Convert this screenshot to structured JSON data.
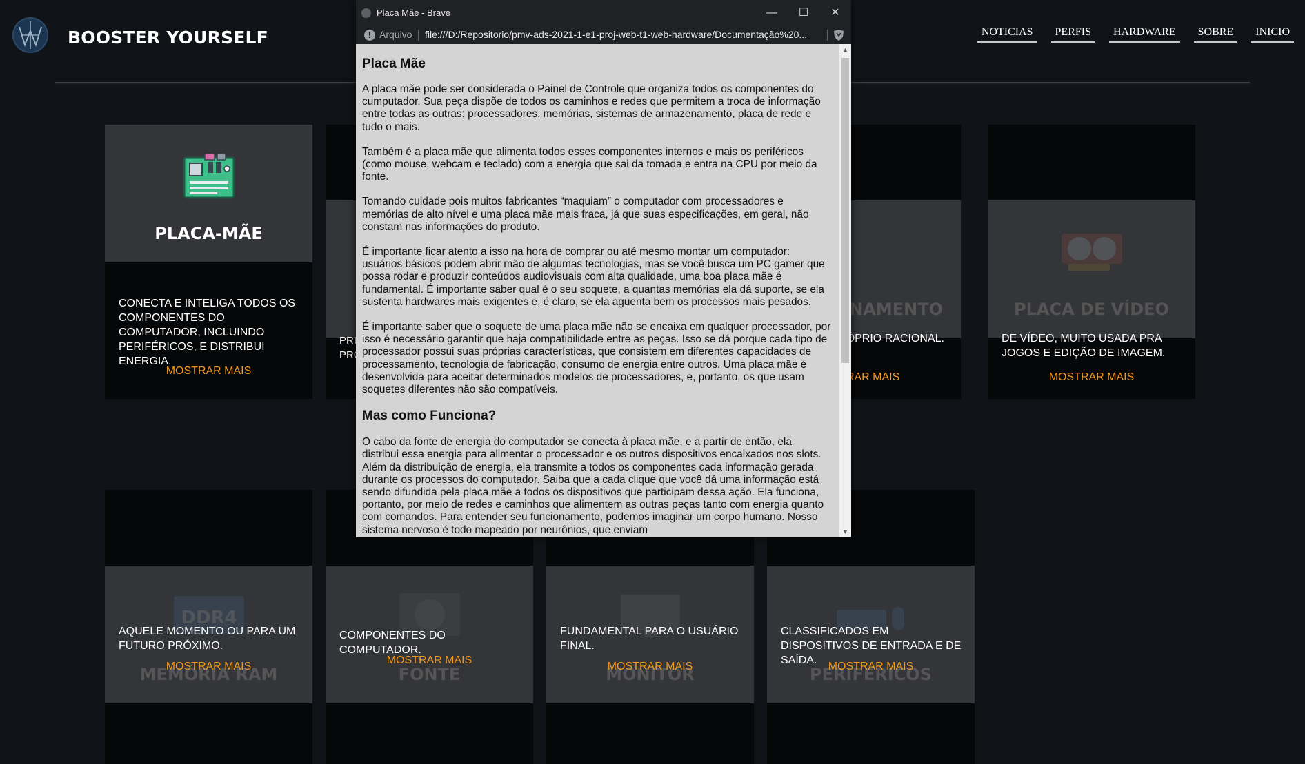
{
  "site": {
    "brand": "BOOSTER YOURSELF",
    "nav": [
      "NOTICIAS",
      "PERFIS",
      "HARDWARE",
      "SOBRE",
      "INICIO"
    ]
  },
  "cards": {
    "row1": [
      {
        "title": "PLACA-MÃE",
        "icon": "motherboard-icon",
        "text": "CONECTA E INTELIGA TODOS OS COMPONENTES DO COMPUTADOR, INCLUINDO PERIFÉRICOS, E DISTRIBUI ENERGIA.",
        "more": "MOSTRAR MAIS"
      },
      {
        "title": "",
        "icon": "cpu-icon",
        "text": "PRI PRO",
        "more": ""
      },
      {
        "title": "",
        "icon": "",
        "text": "",
        "more": ""
      },
      {
        "title": "ARMAZENAMENTO",
        "title_visible": "ZENAMENTO",
        "icon": "hdd-icon",
        "text_visible": "JOGOS E O PRÓPRIO RACIONAL.",
        "more": "MOSTRAR MAIS",
        "more_visible": "STRAR MAIS"
      },
      {
        "title": "PLACA DE VÍDEO",
        "icon": "gpu-icon",
        "text": "DE VÍDEO, MUITO USADA PRA JOGOS E EDIÇÃO DE IMAGEM.",
        "more": "MOSTRAR MAIS"
      }
    ],
    "row2": [
      {
        "title": "MEMÓRIA RAM",
        "icon": "ram-icon",
        "icon_text": "DDR4",
        "text": "AQUELE MOMENTO OU PARA UM FUTURO PRÓXIMO.",
        "more": "MOSTRAR MAIS"
      },
      {
        "title": "FONTE",
        "icon": "psu-icon",
        "text": "COMPONENTES DO COMPUTADOR.",
        "more": "MOSTRAR MAIS"
      },
      {
        "title": "MONITOR",
        "icon": "monitor-icon",
        "text": "FUNDAMENTAL PARA O USUÁRIO FINAL.",
        "more": "MOSTRAR MAIS"
      },
      {
        "title": "PERIFÉRICOS",
        "icon": "keyboard-mouse-icon",
        "text": "CLASSIFICADOS EM DISPOSITIVOS DE ENTRADA E DE SAÍDA.",
        "more": "MOSTRAR MAIS"
      }
    ]
  },
  "popup": {
    "window_title": "Placa Mãe - Brave",
    "address_label": "Arquivo",
    "url": "file:///D:/Repositorio/pmv-ads-2021-1-e1-proj-web-t1-web-hardware/Documentação%20...",
    "h1": "Placa Mãe",
    "paragraphs": [
      "A placa mãe pode ser considerada o Painel de Controle que organiza todos os componentes do cumputador. Sua peça dispõe de todos os caminhos e redes que permitem a troca de informação entre todas as outras: processadores, memórias, sistemas de armazenamento, placa de rede e tudo o mais.",
      "Também é a placa mãe que alimenta todos esses componentes internos e mais os periféricos (como mouse, webcam e teclado) com a energia que sai da tomada e entra na CPU por meio da fonte.",
      "Tomando cuidade pois muitos fabricantes “maquiam” o computador com processadores e memórias de alto nível e uma placa mãe mais fraca, já que suas especificações, em geral, não constam nas informações do produto.",
      "É importante ficar atento a isso na hora de comprar ou até mesmo montar um computador: usuários básicos podem abrir mão de algumas tecnologias, mas se você busca um PC gamer que possa rodar e produzir conteúdos audiovisuais com alta qualidade, uma boa placa mãe é fundamental. É importante saber qual é o seu soquete, a quantas memórias ela dá suporte, se ela sustenta hardwares mais exigentes e, é claro, se ela aguenta bem os processos mais pesados.",
      "É importante saber que o soquete de uma placa mãe não se encaixa em qualquer processador, por isso é necessário garantir que haja compatibilidade entre as peças. Isso se dá porque cada tipo de processador possui suas próprias características, que consistem em diferentes capacidades de processamento, tecnologia de fabricação, consumo de energia entre outros. Uma placa mãe é desenvolvida para aceitar determinados modelos de processadores, e, portanto, os que usam soquetes diferentes não são compatíveis."
    ],
    "h2": "Mas como Funciona?",
    "paragraphs2": [
      "O cabo da fonte de energia do computador se conecta à placa mãe, e a partir de então, ela distribui essa energia para alimentar o processador e os outros dispositivos encaixados nos slots. Além da distribuição de energia, ela transmite a todos os componentes cada informação gerada durante os processos do computador. Saiba que a cada clique que você dá uma informação está sendo difundida pela placa mãe a todos os dispositivos que participam dessa ação. Ela funciona, portanto, por meio de redes e caminhos que alimentem as outras peças tanto com energia quanto com comandos. Para entender seu funcionamento, podemos imaginar um corpo humano. Nosso sistema nervoso é todo mapeado por neurônios, que enviam"
    ]
  }
}
